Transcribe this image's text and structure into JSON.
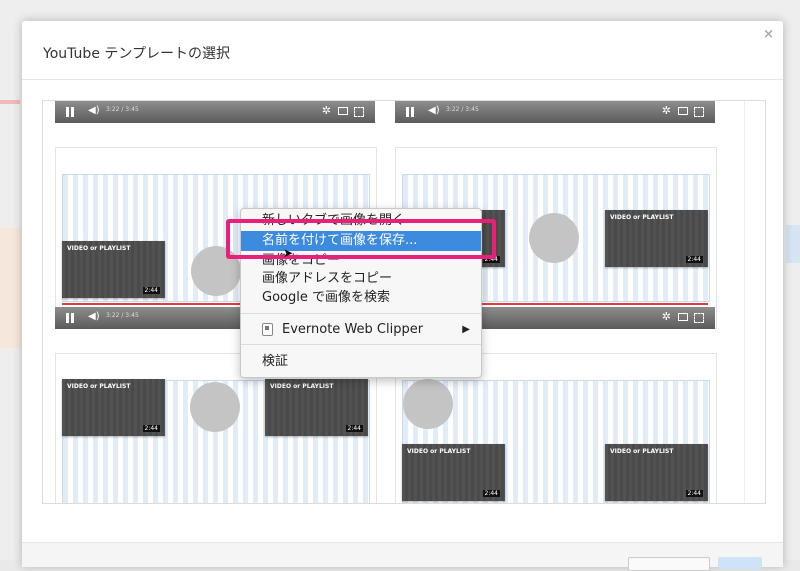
{
  "dialog": {
    "title": "YouTube テンプレートの選択",
    "close_glyph": "×"
  },
  "player": {
    "time_text": "3:22 / 3:45"
  },
  "templates": {
    "video_label": "VIDEO or PLAYLIST",
    "duration": "2:44"
  },
  "context_menu": {
    "items": [
      {
        "label": "新しいタブで画像を開く"
      },
      {
        "label": "名前を付けて画像を保存..."
      },
      {
        "label": "画像をコピー"
      },
      {
        "label": "画像アドレスをコピー"
      },
      {
        "label": "Google で画像を検索"
      },
      {
        "label": "Evernote Web Clipper"
      },
      {
        "label": "検証"
      }
    ],
    "submenu_arrow": "▶",
    "selected_index": 1
  },
  "colors": {
    "highlight": "#e8207a",
    "menu_selected": "#3d8bde"
  }
}
